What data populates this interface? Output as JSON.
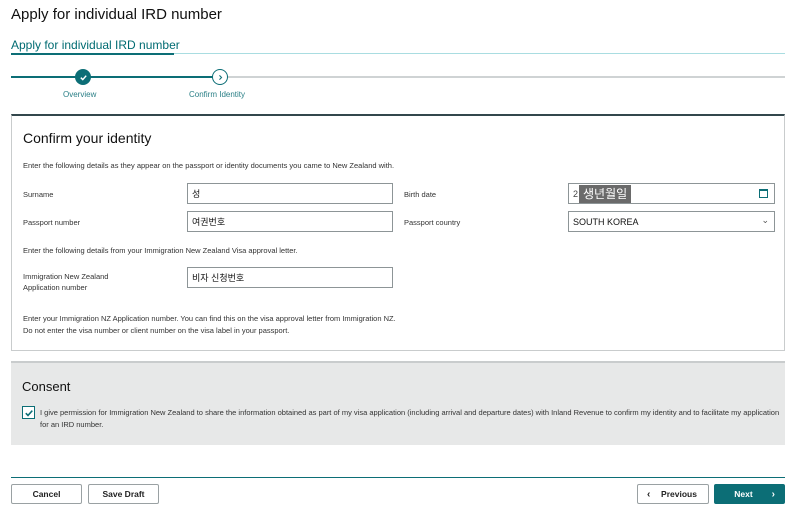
{
  "page": {
    "title": "Apply for individual IRD number"
  },
  "tab": {
    "label": "Apply for individual IRD number"
  },
  "stepper": {
    "steps": [
      {
        "label": "Overview",
        "state": "complete"
      },
      {
        "label": "Confirm Identity",
        "state": "current"
      }
    ]
  },
  "identity": {
    "title": "Confirm your identity",
    "intro": "Enter the following details as they appear on the passport or identity documents you came to New Zealand with.",
    "surname": {
      "label": "Surname",
      "value": "성"
    },
    "birth_date": {
      "label": "Birth date",
      "prefix": "2",
      "value": "생년월일"
    },
    "passport_number": {
      "label": "Passport number",
      "value": "여권번호"
    },
    "passport_country": {
      "label": "Passport country",
      "value": "SOUTH KOREA"
    },
    "visa_intro": "Enter the following details from your Immigration New Zealand Visa approval letter.",
    "application_number": {
      "label_line1": "Immigration New Zealand",
      "label_line2": "Application number",
      "value": "비자 신청번호"
    },
    "hint_line1": "Enter your Immigration NZ Application number. You can find this on the visa approval letter from Immigration NZ.",
    "hint_line2": "Do not enter the visa number or client number on the visa label in your passport."
  },
  "consent": {
    "title": "Consent",
    "checked": true,
    "text": "I give permission for Immigration New Zealand to share the information obtained as part of my visa application (including arrival and departure dates) with Inland Revenue to confirm my identity and to facilitate my application for an IRD number."
  },
  "footer": {
    "cancel": "Cancel",
    "save_draft": "Save Draft",
    "previous": "Previous",
    "next": "Next"
  },
  "colors": {
    "accent": "#0c6e76",
    "consent_bg": "#e7e8e8"
  },
  "icons": [
    "check-icon",
    "chevron-right-icon",
    "calendar-icon",
    "chevron-down-icon",
    "arrow-left-icon",
    "arrow-right-icon"
  ]
}
